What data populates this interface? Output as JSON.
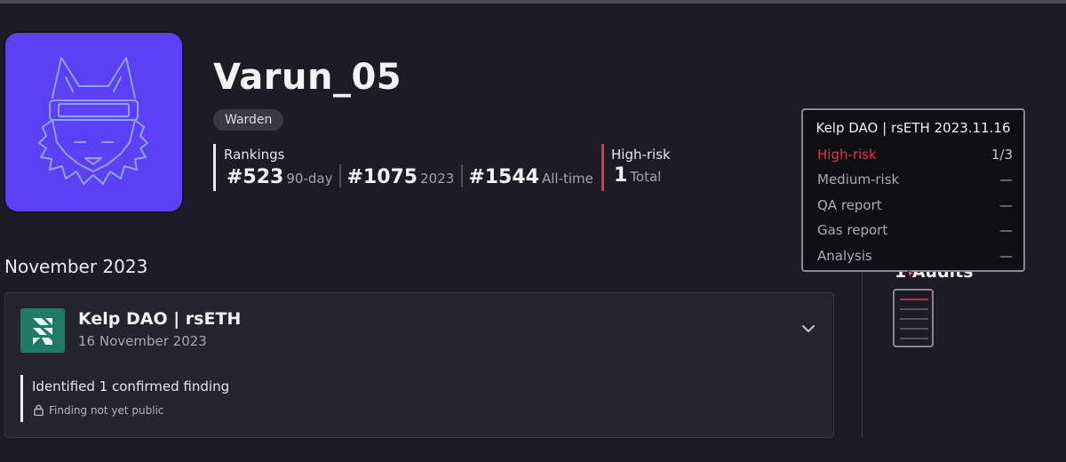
{
  "profile": {
    "username": "Varun_05",
    "role": "Warden",
    "rankings_title": "Rankings",
    "rankings": [
      {
        "rank": "#523",
        "label": "90-day"
      },
      {
        "rank": "#1075",
        "label": "2023"
      },
      {
        "rank": "#1544",
        "label": "All-time"
      }
    ],
    "high_risk_title": "High-risk",
    "high_risk_count": "1",
    "high_risk_label": "Total"
  },
  "timeline": {
    "month_heading": "November 2023",
    "audit": {
      "name": "Kelp DAO | rsETH",
      "date": "16 November 2023",
      "finding": "Identified 1 confirmed finding",
      "note": "Finding not yet public"
    }
  },
  "side": {
    "audits_title": "1 Audits"
  },
  "tooltip": {
    "title": "Kelp DAO | rsETH 2023.11.16",
    "rows": [
      {
        "label": "High-risk",
        "value": "1/3"
      },
      {
        "label": "Medium-risk",
        "value": "—"
      },
      {
        "label": "QA report",
        "value": "—"
      },
      {
        "label": "Gas report",
        "value": "—"
      },
      {
        "label": "Analysis",
        "value": "—"
      }
    ]
  },
  "colors": {
    "background": "#1d1b25",
    "avatar": "#5b40f5",
    "high_risk_accent": "#e2344f",
    "logo": "#1f7a67"
  },
  "icons": [
    "warden-avatar-icon",
    "kelp-logo-icon",
    "chevron-down-icon",
    "lock-icon",
    "audit-document-icon"
  ]
}
